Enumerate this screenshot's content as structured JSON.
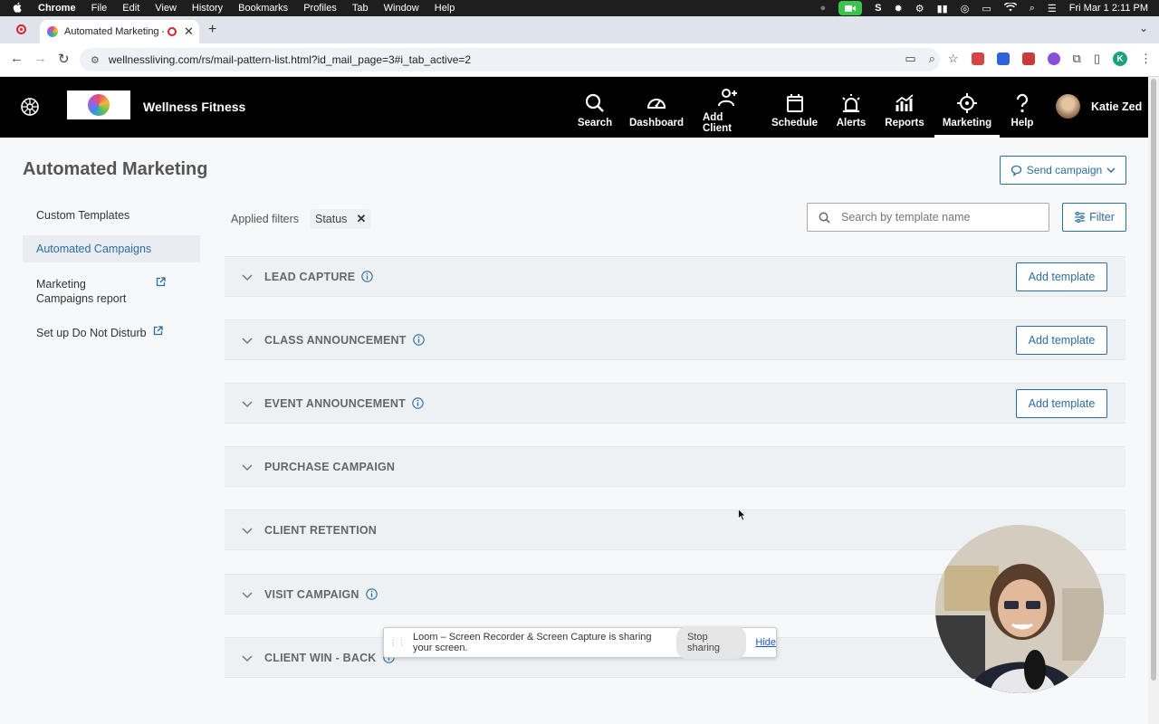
{
  "menubar": {
    "app": "Chrome",
    "items": [
      "File",
      "Edit",
      "View",
      "History",
      "Bookmarks",
      "Profiles",
      "Tab",
      "Window",
      "Help"
    ],
    "datetime": "Fri Mar 1  2:11 PM"
  },
  "browser": {
    "tab_title": "Automated Marketing - W",
    "url": "wellnessliving.com/rs/mail-pattern-list.html?id_mail_page=3#i_tab_active=2",
    "profile_initial": "K"
  },
  "header": {
    "brand": "Wellness Fitness",
    "nav": [
      {
        "label": "Search",
        "icon": "search-icon"
      },
      {
        "label": "Dashboard",
        "icon": "dashboard-icon"
      },
      {
        "label": "Add Client",
        "icon": "add-client-icon"
      },
      {
        "label": "Schedule",
        "icon": "calendar-icon"
      },
      {
        "label": "Alerts",
        "icon": "alarm-icon"
      },
      {
        "label": "Reports",
        "icon": "reports-icon"
      },
      {
        "label": "Marketing",
        "icon": "crosshair-icon"
      },
      {
        "label": "Help",
        "icon": "help-icon"
      }
    ],
    "active_nav": "Marketing",
    "user_name": "Katie Zed"
  },
  "page": {
    "title": "Automated Marketing",
    "send_campaign": "Send campaign",
    "applied_filters": "Applied filters",
    "filter_chip": "Status",
    "search_placeholder": "Search by template name",
    "filter_button": "Filter"
  },
  "sidebar": {
    "items": [
      {
        "label": "Custom Templates",
        "active": false
      },
      {
        "label": "Automated Campaigns",
        "active": true
      },
      {
        "label": "Marketing Campaigns report",
        "active": false,
        "external": true
      },
      {
        "label": "Set up Do Not Disturb",
        "active": false,
        "external": true
      }
    ]
  },
  "sections": [
    {
      "label": "LEAD CAPTURE",
      "info": true,
      "button": "Add template"
    },
    {
      "label": "CLASS ANNOUNCEMENT",
      "info": true,
      "button": "Add template"
    },
    {
      "label": "EVENT ANNOUNCEMENT",
      "info": true,
      "button": "Add template"
    },
    {
      "label": "PURCHASE CAMPAIGN",
      "info": false,
      "button": ""
    },
    {
      "label": "CLIENT RETENTION",
      "info": false,
      "button": ""
    },
    {
      "label": "VISIT CAMPAIGN",
      "info": true,
      "button": ""
    },
    {
      "label": "CLIENT WIN - BACK",
      "info": true,
      "button": ""
    }
  ],
  "loom": {
    "message": "Loom – Screen Recorder & Screen Capture is sharing your screen.",
    "stop": "Stop sharing",
    "hide": "Hide"
  },
  "colors": {
    "accent": "#2c6d9f",
    "header_bg": "#000000",
    "section_bg": "#eef1f4"
  }
}
